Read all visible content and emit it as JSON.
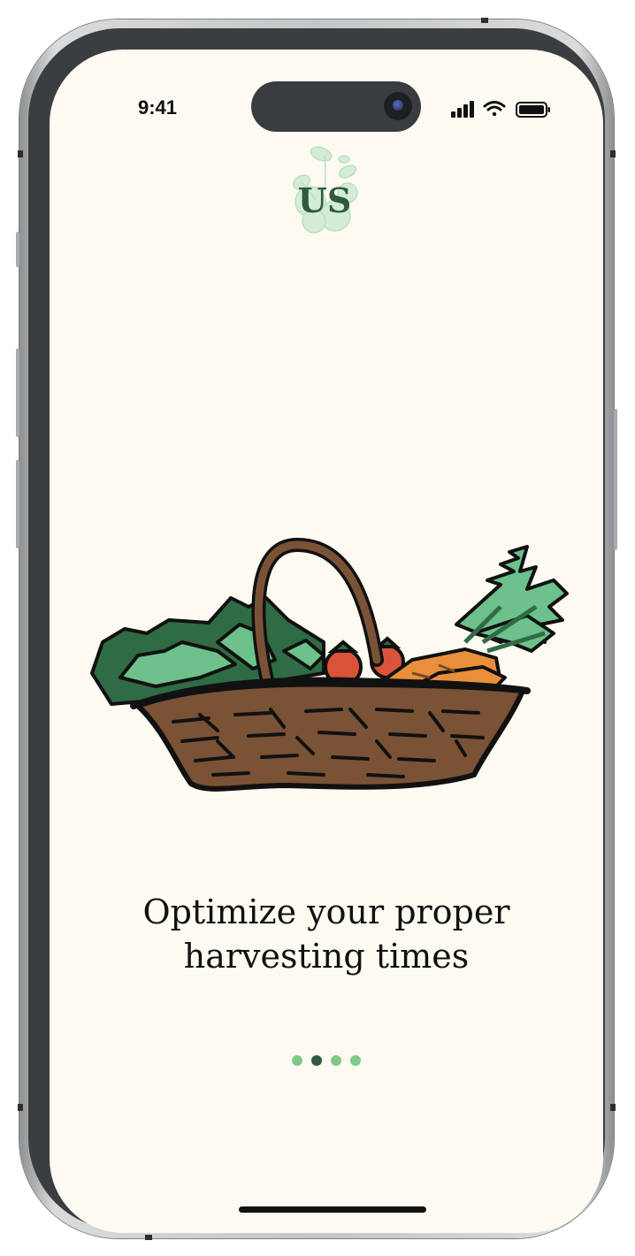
{
  "status_bar": {
    "time": "9:41",
    "icons": [
      "cellular-signal-icon",
      "wifi-icon",
      "battery-icon"
    ]
  },
  "logo": {
    "monogram": "US",
    "colors": {
      "letters": "#2f5a41",
      "leaves": "#b9e0bd"
    }
  },
  "illustration": {
    "subject": "vegetable-basket",
    "colors": {
      "basket": "#7a5236",
      "greens": "#2f6b45",
      "light_greens": "#6cc28a",
      "tomato": "#d9533a",
      "carrot": "#e98f3c"
    }
  },
  "onboarding": {
    "headline_line1": "Optimize your proper",
    "headline_line2": "harvesting times",
    "page_count": 4,
    "active_page": 2
  },
  "colors": {
    "background": "#fdfaf2",
    "dot_inactive": "#7fca8a",
    "dot_active": "#2f5a41",
    "text": "#111111"
  }
}
